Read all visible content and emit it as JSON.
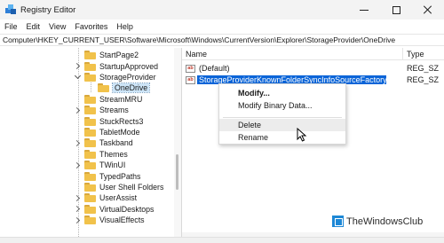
{
  "window": {
    "title": "Registry Editor",
    "controls": [
      "minimize-icon",
      "maximize-icon",
      "close-icon"
    ]
  },
  "menubar": {
    "items": [
      "File",
      "Edit",
      "View",
      "Favorites",
      "Help"
    ]
  },
  "address": {
    "path": "Computer\\HKEY_CURRENT_USER\\Software\\Microsoft\\Windows\\CurrentVersion\\Explorer\\StorageProvider\\OneDrive"
  },
  "tree": {
    "items": [
      {
        "label": "StartPage2",
        "expander": "none",
        "selected": false
      },
      {
        "label": "StartupApproved",
        "expander": "closed",
        "selected": false
      },
      {
        "label": "StorageProvider",
        "expander": "open",
        "selected": false
      },
      {
        "label": "OneDrive",
        "expander": "none",
        "selected": true
      },
      {
        "label": "StreamMRU",
        "expander": "none",
        "selected": false
      },
      {
        "label": "Streams",
        "expander": "closed",
        "selected": false
      },
      {
        "label": "StuckRects3",
        "expander": "none",
        "selected": false
      },
      {
        "label": "TabletMode",
        "expander": "none",
        "selected": false
      },
      {
        "label": "Taskband",
        "expander": "closed",
        "selected": false
      },
      {
        "label": "Themes",
        "expander": "none",
        "selected": false
      },
      {
        "label": "TWinUI",
        "expander": "closed",
        "selected": false
      },
      {
        "label": "TypedPaths",
        "expander": "none",
        "selected": false
      },
      {
        "label": "User Shell Folders",
        "expander": "none",
        "selected": false
      },
      {
        "label": "UserAssist",
        "expander": "closed",
        "selected": false
      },
      {
        "label": "VirtualDesktops",
        "expander": "closed",
        "selected": false
      },
      {
        "label": "VisualEffects",
        "expander": "closed",
        "selected": false
      }
    ]
  },
  "values": {
    "headers": {
      "name": "Name",
      "type": "Type"
    },
    "rows": [
      {
        "icon": "string-value-icon",
        "icon_text": "ab",
        "name": "(Default)",
        "type": "REG_SZ",
        "selected": false
      },
      {
        "icon": "string-value-icon",
        "icon_text": "ab",
        "name": "StorageProviderKnownFolderSyncInfoSourceFactory",
        "type": "REG_SZ",
        "selected": true
      }
    ]
  },
  "context_menu": {
    "items": [
      {
        "label": "Modify...",
        "bold": true,
        "hover": false
      },
      {
        "label": "Modify Binary Data...",
        "bold": false,
        "hover": false
      },
      {
        "label": "Delete",
        "bold": false,
        "hover": true
      },
      {
        "label": "Rename",
        "bold": false,
        "hover": false
      }
    ]
  },
  "watermark": {
    "text": "TheWindowsClub"
  },
  "colors": {
    "selection": "#0a64d8",
    "folder": "#f1c24b",
    "tree_selection": "#cce4f7"
  }
}
